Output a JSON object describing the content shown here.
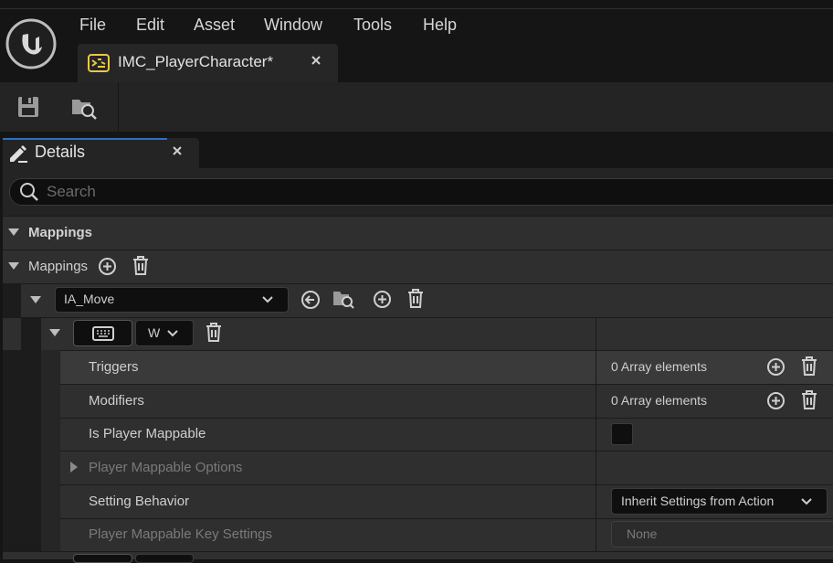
{
  "menu": {
    "items": [
      "File",
      "Edit",
      "Asset",
      "Window",
      "Tools",
      "Help"
    ]
  },
  "asset_tab": {
    "title": "IMC_PlayerCharacter*",
    "icon": "input-mapping-context-icon"
  },
  "toolbar": {
    "save_icon": "save-icon",
    "browse_icon": "browse-in-content-browser-icon"
  },
  "details": {
    "tab_title": "Details",
    "search_placeholder": "Search",
    "category": "Mappings",
    "mappings_label": "Mappings",
    "action": {
      "selected": "IA_Move"
    },
    "key": {
      "selected": "W"
    },
    "properties": [
      {
        "label": "Triggers",
        "value": "0 Array elements"
      },
      {
        "label": "Modifiers",
        "value": "0 Array elements"
      },
      {
        "label": "Is Player Mappable"
      },
      {
        "label": "Player Mappable Options"
      },
      {
        "label": "Setting Behavior",
        "value": "Inherit Settings from Action"
      },
      {
        "label": "Player Mappable Key Settings",
        "value": "None"
      }
    ]
  },
  "colors": {
    "accent": "#2f6fc0",
    "panel": "#242424",
    "row": "#2f2f2f",
    "asset_icon": "#e8c84a"
  }
}
